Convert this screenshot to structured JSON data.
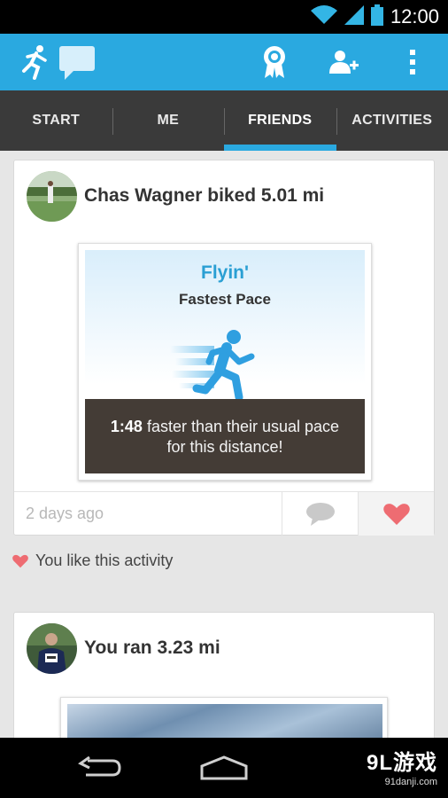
{
  "status_bar": {
    "time": "12:00",
    "icons": [
      "wifi-icon",
      "signal-icon",
      "battery-icon"
    ]
  },
  "action_bar": {
    "color": "#2aa9e0",
    "icons": [
      "runner-logo-icon",
      "chat-bubble-icon",
      "award-ribbon-icon",
      "add-friend-icon",
      "overflow-menu-icon"
    ]
  },
  "tabs": [
    {
      "label": "START",
      "active": false
    },
    {
      "label": "ME",
      "active": false
    },
    {
      "label": "FRIENDS",
      "active": true
    },
    {
      "label": "ACTIVITIES",
      "active": false
    }
  ],
  "feed": [
    {
      "title": "Chas Wagner biked 5.01 mi",
      "badge": {
        "name": "Flyin'",
        "subtitle": "Fastest Pace",
        "highlight": "1:48",
        "description_line1": " faster than their usual pace",
        "description_line2": "for this distance!"
      },
      "time_ago": "2 days ago",
      "liked": true,
      "like_text": "You like this activity"
    },
    {
      "title": "You ran 3.23 mi"
    }
  ],
  "nav_bar": {
    "icons": [
      "back-icon",
      "home-icon"
    ]
  },
  "watermark": {
    "logo": "9L游戏",
    "url": "91danji.com"
  }
}
